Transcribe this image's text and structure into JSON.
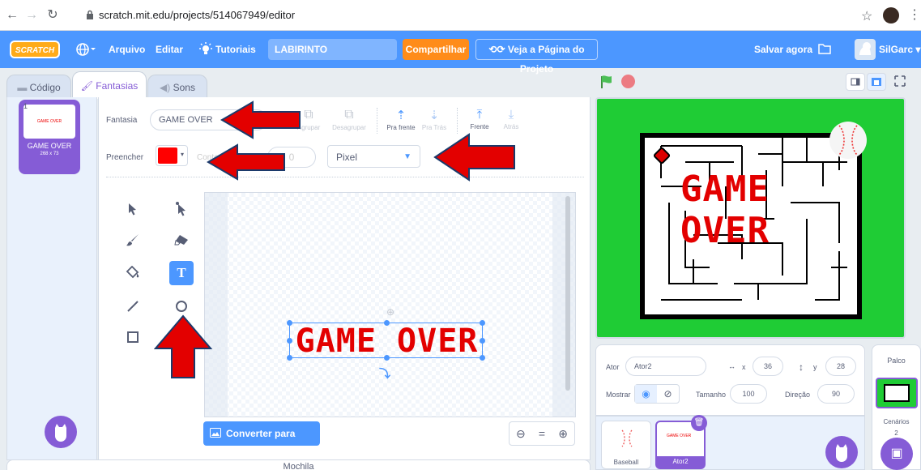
{
  "browser": {
    "url": "scratch.mit.edu/projects/514067949/editor"
  },
  "menubar": {
    "logo": "SCRATCH",
    "file": "Arquivo",
    "edit": "Editar",
    "tutorials": "Tutoriais",
    "project_title": "LABIRINTO",
    "share": "Compartilhar",
    "see_project_page": "Veja a Página do Projeto",
    "save_now": "Salvar agora",
    "user": "SilGarc"
  },
  "tabs": {
    "code": "Código",
    "costumes": "Fantasias",
    "sounds": "Sons"
  },
  "costume_list": [
    {
      "number": "1",
      "name": "GAME OVER",
      "size": "268 x 73",
      "thumb_text": "GAME OVER"
    }
  ],
  "paint_editor": {
    "costume_label": "Fantasia",
    "costume_name": "GAME OVER",
    "fill_label": "Preencher",
    "fill_color": "#ff0000",
    "outline_label": "Contorno",
    "outline_width": "0",
    "font": "Pixel",
    "buttons": {
      "group": "Agrupar",
      "ungroup": "Desagrupar",
      "forward": "Pra frente",
      "backward": "Pra Trás",
      "front": "Frente",
      "back": "Atrás"
    },
    "canvas_text": "GAME OVER",
    "convert_bitmap": "Converter para Bitmap",
    "zoom_equal": "="
  },
  "backpack": "Mochila",
  "stage": {
    "game_over_text": "GAME OVER"
  },
  "sprite_info": {
    "sprite_label": "Ator",
    "sprite_name": "Ator2",
    "x_label": "x",
    "x_value": "36",
    "y_label": "y",
    "y_value": "28",
    "show_label": "Mostrar",
    "size_label": "Tamanho",
    "size_value": "100",
    "direction_label": "Direção",
    "direction_value": "90"
  },
  "sprites": [
    {
      "name": "Baseball"
    },
    {
      "name": "Ator2",
      "thumb_text": "GAME OVER"
    }
  ],
  "stage_panel": {
    "title": "Palco",
    "backdrops_label": "Cenários",
    "backdrops_count": "2"
  }
}
